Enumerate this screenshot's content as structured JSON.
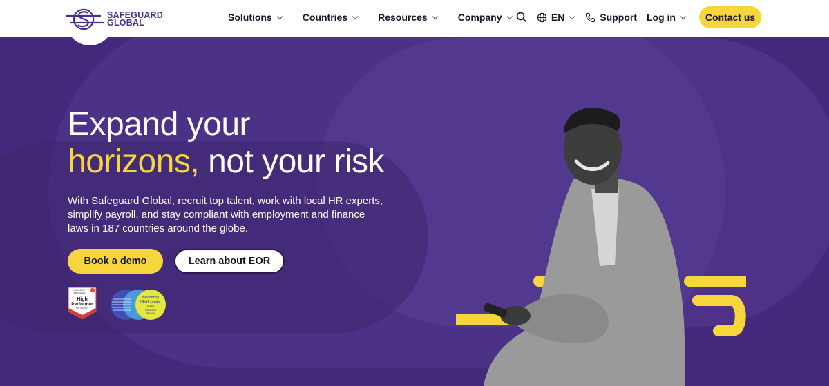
{
  "brand": {
    "name_line1": "SAFEGUARD",
    "name_line2": "GLOBAL"
  },
  "nav": {
    "items": [
      {
        "label": "Solutions"
      },
      {
        "label": "Countries"
      },
      {
        "label": "Resources"
      },
      {
        "label": "Company"
      }
    ]
  },
  "utility": {
    "language": "EN",
    "support": "Support",
    "login": "Log in",
    "contact": "Contact us"
  },
  "hero": {
    "headline_line1": "Expand your",
    "headline_highlight": "horizons,",
    "headline_rest": " not your risk",
    "subtext": "With Safeguard Global, recruit top talent, work with local HR experts, simplify payroll, and stay compliant with employment and finance laws in 187 countries around the globe.",
    "primary_cta": "Book a demo",
    "secondary_cta": "Learn about EOR"
  },
  "badges": {
    "g2": {
      "season": "FALL 2025",
      "region": "AMERICAS",
      "line1": "High",
      "line2": "Performer",
      "category": "MID-MARKET"
    },
    "nelsonhall": {
      "line1": "NelsonHall",
      "line2": "NEAT Leader",
      "year": "2025",
      "line3": "Global EOR",
      "line4": "Services"
    }
  },
  "colors": {
    "brand_purple": "#43287c",
    "accent_yellow": "#f6d63c",
    "logo_purple": "#4a2f8a"
  },
  "icons": [
    "search-icon",
    "globe-icon",
    "phone-icon",
    "chevron-down-icon"
  ]
}
